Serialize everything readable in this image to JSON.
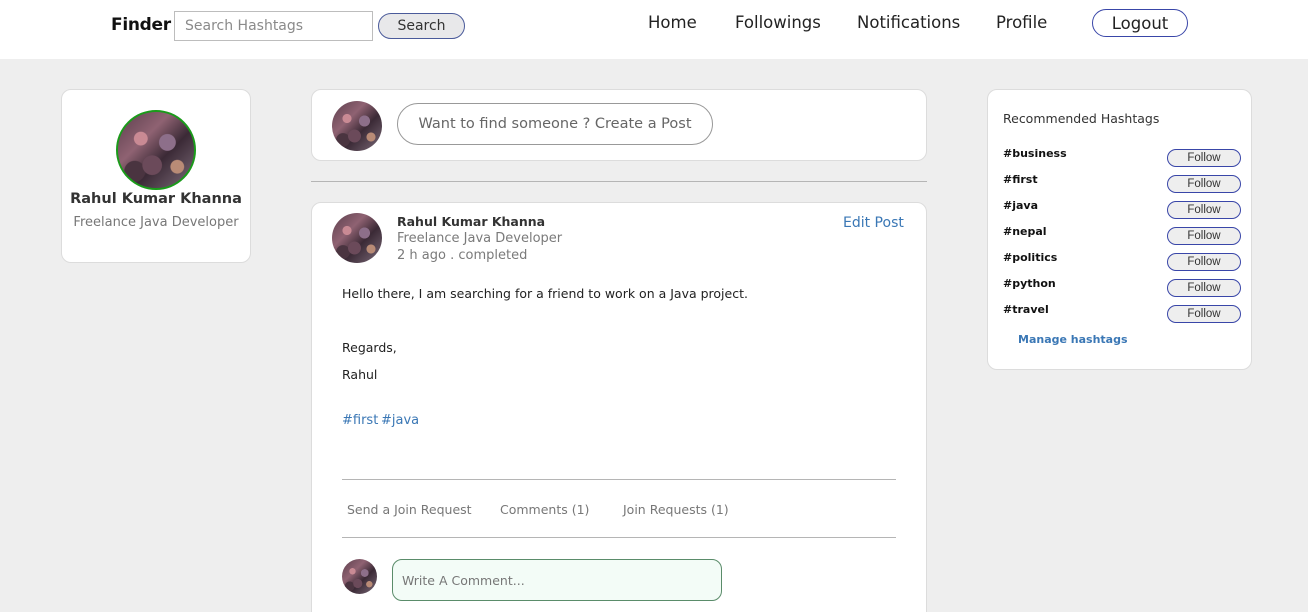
{
  "header": {
    "brand": "Finder",
    "search_placeholder": "Search Hashtags",
    "search_button": "Search",
    "nav": [
      "Home",
      "Followings",
      "Notifications",
      "Profile"
    ],
    "logout": "Logout"
  },
  "profile": {
    "name": "Rahul Kumar Khanna",
    "title": "Freelance Java Developer"
  },
  "composer": {
    "button_label": "Want to find someone ? Create a Post"
  },
  "post": {
    "author": "Rahul Kumar Khanna",
    "subtitle": "Freelance Java Developer",
    "meta": "2 h ago . completed",
    "edit_label": "Edit Post",
    "body": [
      "Hello there, I am searching for a friend to work on a Java  project.",
      "Regards,",
      "Rahul"
    ],
    "tags": [
      "#first",
      "#java"
    ],
    "actions": [
      "Send a Join Request",
      "Comments (1)",
      "Join Requests (1)"
    ],
    "comment_placeholder": "Write A Comment..."
  },
  "recommended": {
    "title": "Recommended Hashtags",
    "hashtags": [
      "#business",
      "#first",
      "#java",
      "#nepal",
      "#politics",
      "#python",
      "#travel"
    ],
    "follow_label": "Follow",
    "manage_label": "Manage hashtags"
  },
  "colors": {
    "page_bg": "#eeeeee",
    "link": "#3a77b5",
    "avatar_ring": "#1a9b1a",
    "button_border": "#3946a8"
  }
}
